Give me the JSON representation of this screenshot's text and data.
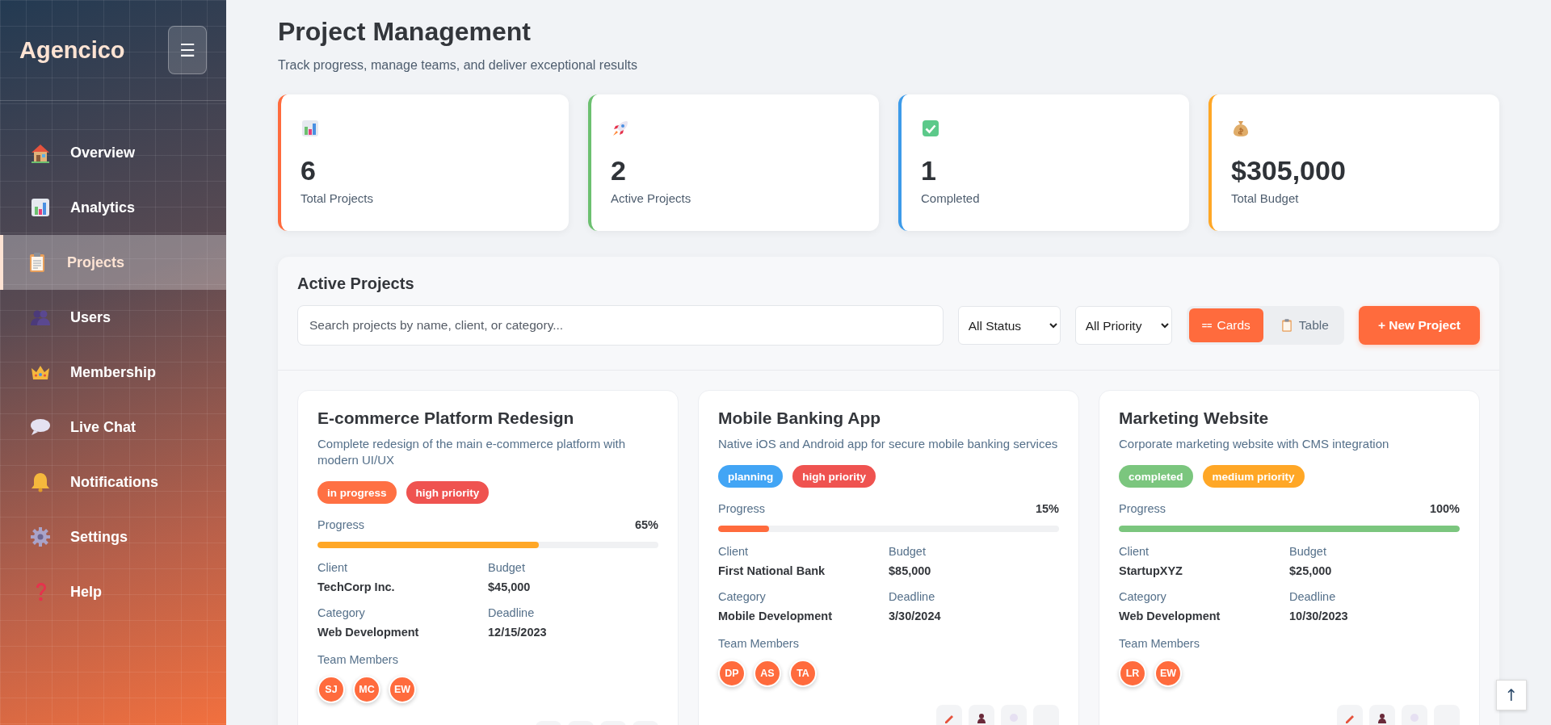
{
  "sidebar": {
    "logo": "Agencico",
    "menu_button": "☰",
    "items": [
      {
        "label": "Overview",
        "selected": false
      },
      {
        "label": "Analytics",
        "selected": false
      },
      {
        "label": "Projects",
        "selected": true
      },
      {
        "label": "Users",
        "selected": false
      },
      {
        "label": "Membership",
        "selected": false
      },
      {
        "label": "Live Chat",
        "selected": false
      },
      {
        "label": "Notifications",
        "selected": false
      },
      {
        "label": "Settings",
        "selected": false
      },
      {
        "label": "Help",
        "selected": false
      }
    ]
  },
  "header": {
    "title": "Project Management",
    "subtitle": "Track progress, manage teams, and deliver exceptional results"
  },
  "stats": [
    {
      "value": "6",
      "label": "Total Projects",
      "color": "#ff6b3d"
    },
    {
      "value": "2",
      "label": "Active Projects",
      "color": "#6cc070"
    },
    {
      "value": "1",
      "label": "Completed",
      "color": "#3d9be9"
    },
    {
      "value": "$305,000",
      "label": "Total Budget",
      "color": "#ffa726"
    }
  ],
  "panel": {
    "title": "Active Projects",
    "search": {
      "placeholder": "Search projects by name, client, or category..."
    },
    "filters": [
      {
        "value": "All Status"
      },
      {
        "value": "All Priority"
      }
    ],
    "view_toggle": [
      {
        "glyph": "==",
        "label": "Cards",
        "selected": true
      },
      {
        "label": "Table",
        "selected": false
      }
    ],
    "new_button": "+ New Project",
    "projects": [
      {
        "title": "E-commerce Platform Redesign",
        "description": "Complete redesign of the main e-commerce platform with modern UI/UX",
        "badges": [
          {
            "label": "in progress",
            "color": "#ff7043"
          },
          {
            "label": "high priority",
            "color": "#ef5350"
          }
        ],
        "progress_label": "Progress",
        "progress_text": "65%",
        "level": 0.65,
        "fields": [
          {
            "label": "Client",
            "value": "TechCorp Inc."
          },
          {
            "label": "Budget",
            "value": "$45,000"
          },
          {
            "label": "Category",
            "value": "Web Development"
          },
          {
            "label": "Deadline",
            "value": "12/15/2023"
          }
        ],
        "team_label": "Team Members",
        "team": [
          "SJ",
          "MC",
          "EW"
        ]
      },
      {
        "title": "Mobile Banking App",
        "description": "Native iOS and Android app for secure mobile banking services",
        "badges": [
          {
            "label": "planning",
            "color": "#42a5f5"
          },
          {
            "label": "high priority",
            "color": "#ef5350"
          }
        ],
        "progress_label": "Progress",
        "progress_text": "15%",
        "level": 0.15,
        "fields": [
          {
            "label": "Client",
            "value": "First National Bank"
          },
          {
            "label": "Budget",
            "value": "$85,000"
          },
          {
            "label": "Category",
            "value": "Mobile Development"
          },
          {
            "label": "Deadline",
            "value": "3/30/2024"
          }
        ],
        "team_label": "Team Members",
        "team": [
          "DP",
          "AS",
          "TA"
        ]
      },
      {
        "title": "Marketing Website",
        "description": "Corporate marketing website with CMS integration",
        "badges": [
          {
            "label": "completed",
            "color": "#7bc67e"
          },
          {
            "label": "medium priority",
            "color": "#ffa726"
          }
        ],
        "progress_label": "Progress",
        "progress_text": "100%",
        "level": 1,
        "fields": [
          {
            "label": "Client",
            "value": "StartupXYZ"
          },
          {
            "label": "Budget",
            "value": "$25,000"
          },
          {
            "label": "Category",
            "value": "Web Development"
          },
          {
            "label": "Deadline",
            "value": "10/30/2023"
          }
        ],
        "team_label": "Team Members",
        "team": [
          "LR",
          "EW"
        ]
      }
    ]
  },
  "scroll_top": "↑"
}
